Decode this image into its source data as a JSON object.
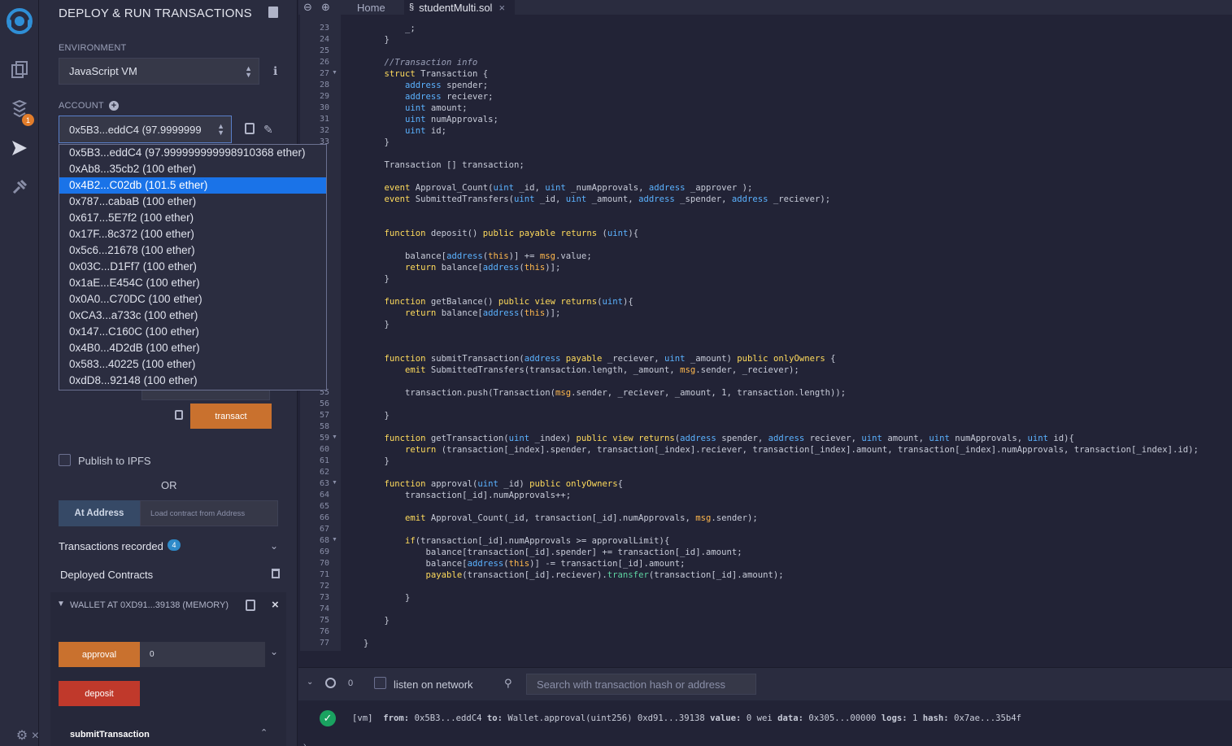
{
  "panel": {
    "title": "DEPLOY & RUN TRANSACTIONS",
    "environment_label": "ENVIRONMENT",
    "environment_value": "JavaScript VM",
    "account_label": "ACCOUNT",
    "account_value": "0x5B3...eddC4 (97.9999999",
    "accounts": [
      "0x5B3...eddC4 (97.999999999998910368 ether)",
      "0xAb8...35cb2 (100 ether)",
      "0x4B2...C02db (101.5 ether)",
      "0x787...cabaB (100 ether)",
      "0x617...5E7f2 (100 ether)",
      "0x17F...8c372 (100 ether)",
      "0x5c6...21678 (100 ether)",
      "0x03C...D1Ff7 (100 ether)",
      "0x1aE...E454C (100 ether)",
      "0x0A0...C70DC (100 ether)",
      "0xCA3...a733c (100 ether)",
      "0x147...C160C (100 ether)",
      "0x4B0...4D2dB (100 ether)",
      "0x583...40225 (100 ether)",
      "0xdD8...92148 (100 ether)"
    ],
    "selected_account_index": 2,
    "transact_label": "transact",
    "publish_ipfs_label": "Publish to IPFS",
    "or_label": "OR",
    "at_address_label": "At Address",
    "at_address_placeholder": "Load contract from Address",
    "tx_recorded_label": "Transactions recorded",
    "tx_recorded_count": "4",
    "deployed_label": "Deployed Contracts",
    "instance_label": "WALLET AT 0XD91...39138 (MEMORY)",
    "approval_label": "approval",
    "approval_value": "0",
    "deposit_label": "deposit",
    "submit_label": "submitTransaction"
  },
  "tabs": {
    "home": "Home",
    "file": "studentMulti.sol"
  },
  "terminal": {
    "count": "0",
    "listen_label": "listen on network",
    "search_placeholder": "Search with transaction hash or address",
    "log_prefix": "[vm]",
    "log_from_label": "from:",
    "log_from": "0x5B3...eddC4",
    "log_to_label": "to:",
    "log_to": "Wallet.approval(uint256) 0xd91...39138",
    "log_value_label": "value:",
    "log_value": "0 wei",
    "log_data_label": "data:",
    "log_data": "0x305...00000",
    "log_logs_label": "logs:",
    "log_logs": "1",
    "log_hash_label": "hash:",
    "log_hash": "0x7ae...35b4f"
  },
  "code": [
    {
      "ln": "23",
      "text": "        _;"
    },
    {
      "ln": "24",
      "text": "    }"
    },
    {
      "ln": "25",
      "text": ""
    },
    {
      "ln": "26",
      "text": "    //Transaction info"
    },
    {
      "ln": "27",
      "text": "    struct Transaction {"
    },
    {
      "ln": "28",
      "text": "        address spender;"
    },
    {
      "ln": "29",
      "text": "        address reciever;"
    },
    {
      "ln": "30",
      "text": "        uint amount;"
    },
    {
      "ln": "31",
      "text": "        uint numApprovals;"
    },
    {
      "ln": "32",
      "text": "        uint id;"
    },
    {
      "ln": "33",
      "text": "    }"
    },
    {
      "ln": "55",
      "text": ""
    },
    {
      "ln": "56",
      "text": ""
    },
    {
      "ln": "57",
      "text": "    }"
    },
    {
      "ln": "58",
      "text": ""
    },
    {
      "ln": "59",
      "text": "    function getTransaction(uint _index) public view returns(address spender, address reciever, uint amount, uint numApprovals, uint id){"
    },
    {
      "ln": "60",
      "text": "        return (transaction[_index].spender, transaction[_index].reciever, transaction[_index].amount, transaction[_index].numApprovals, transaction[_index].id);"
    },
    {
      "ln": "61",
      "text": "    }"
    },
    {
      "ln": "62",
      "text": ""
    },
    {
      "ln": "63",
      "text": "    function approval(uint _id) public onlyOwners{"
    },
    {
      "ln": "64",
      "text": "        transaction[_id].numApprovals++;"
    },
    {
      "ln": "65",
      "text": ""
    },
    {
      "ln": "66",
      "text": "        emit Approval_Count(_id, transaction[_id].numApprovals, msg.sender);"
    },
    {
      "ln": "67",
      "text": ""
    },
    {
      "ln": "68",
      "text": "        if(transaction[_id].numApprovals >= approvalLimit){"
    },
    {
      "ln": "69",
      "text": "            balance[transaction[_id].spender] += transaction[_id].amount;"
    },
    {
      "ln": "70",
      "text": "            balance[address(this)] -= transaction[_id].amount;"
    },
    {
      "ln": "71",
      "text": "            payable(transaction[_id].reciever).transfer(transaction[_id].amount);"
    },
    {
      "ln": "72",
      "text": ""
    },
    {
      "ln": "73",
      "text": "        }"
    },
    {
      "ln": "74",
      "text": ""
    },
    {
      "ln": "75",
      "text": "    }"
    },
    {
      "ln": "76",
      "text": ""
    },
    {
      "ln": "77",
      "text": "}"
    }
  ],
  "code_hidden_by_dropdown": [
    "    Transaction [] transaction;",
    "    event Approval_Count(uint _id, uint _numApprovals, address _approver );",
    "    event SubmittedTransfers(uint _id, uint _amount, address _spender, address _reciever);",
    "    function deposit() public payable returns (uint){",
    "        balance[address(this)] += msg.value;",
    "        return balance[address(this)];",
    "    }",
    "    function getBalance() public view returns(uint){",
    "        return balance[address(this)];",
    "    }",
    "    function submitTransaction(address payable _reciever, uint _amount) public onlyOwners {",
    "        emit SubmittedTransfers(transaction.length, _amount, msg.sender, _reciever);",
    "        transaction.push(Transaction(msg.sender, _reciever, _amount, 1, transaction.length));"
  ],
  "colors": {
    "accent_orange": "#c9712e",
    "selected_blue": "#1a73e8",
    "success_green": "#1aa260"
  }
}
